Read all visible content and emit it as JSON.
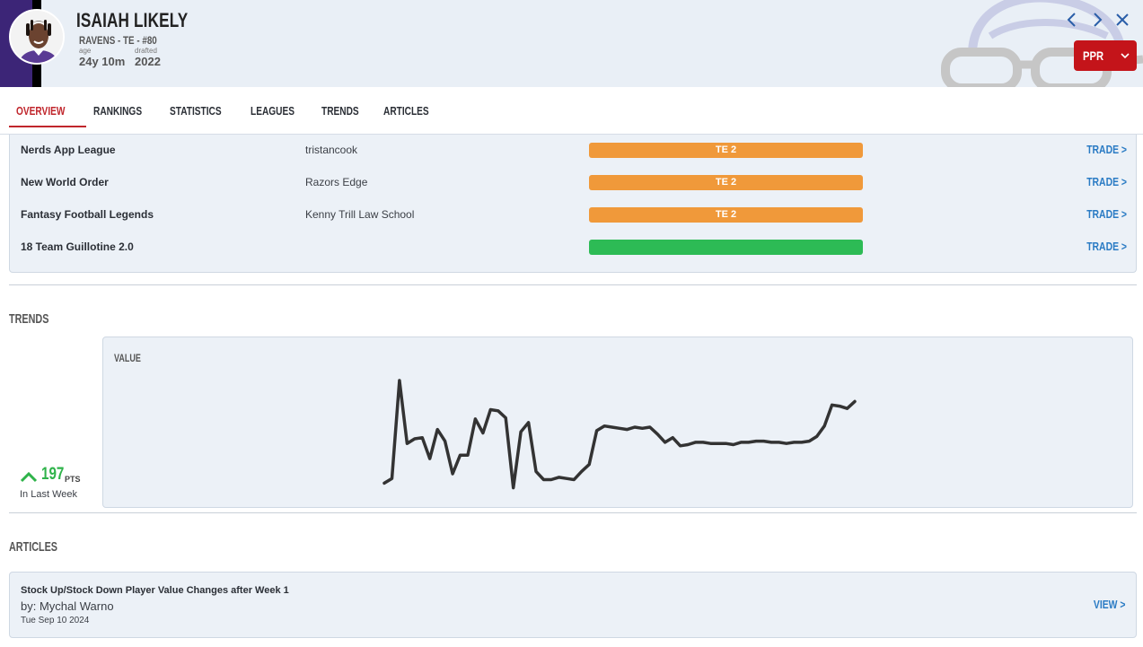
{
  "header": {
    "player_name": "ISAIAH LIKELY",
    "team_line": "RAVENS - TE - #80",
    "age_label": "age",
    "age_value": "24y 10m",
    "drafted_label": "drafted",
    "drafted_value": "2022",
    "scoring_format": "PPR",
    "team_colors": {
      "primary": "#3c2577",
      "secondary": "#000000"
    }
  },
  "nav": {
    "icons": [
      "chevron-left-icon",
      "chevron-right-icon",
      "close-icon"
    ]
  },
  "tabs": [
    {
      "label": "OVERVIEW",
      "active": true
    },
    {
      "label": "RANKINGS",
      "active": false
    },
    {
      "label": "STATISTICS",
      "active": false
    },
    {
      "label": "LEAGUES",
      "active": false
    },
    {
      "label": "TRENDS",
      "active": false
    },
    {
      "label": "ARTICLES",
      "active": false
    }
  ],
  "leagues": [
    {
      "name": "Nerds App League",
      "team": "tristancook",
      "rank": "TE 2",
      "color": "#f0993a",
      "action": "TRADE >"
    },
    {
      "name": "New World Order",
      "team": "Razors Edge",
      "rank": "TE 2",
      "color": "#f0993a",
      "action": "TRADE >"
    },
    {
      "name": "Fantasy Football Legends",
      "team": "Kenny Trill Law School",
      "rank": "TE 2",
      "color": "#f0993a",
      "action": "TRADE >"
    },
    {
      "name": "18 Team Guillotine 2.0",
      "team": "",
      "rank": "",
      "color": "#2dbb55",
      "action": "TRADE >"
    }
  ],
  "trends": {
    "section_title": "TRENDS",
    "change_value": "197",
    "change_unit": "PTS",
    "change_caption": "In Last Week",
    "change_direction": "up",
    "change_color": "#2fb34a"
  },
  "chart_data": {
    "type": "line",
    "title": "VALUE",
    "xlabel": "",
    "ylabel": "",
    "grid": false,
    "legend": "none",
    "ylim": [
      0,
      100
    ],
    "series": [
      {
        "color": "#333333",
        "values": [
          12,
          16,
          100,
          46,
          50,
          51,
          33,
          58,
          48,
          20,
          36,
          36,
          67,
          55,
          75,
          74,
          68,
          8,
          56,
          64,
          22,
          15,
          15,
          17,
          16,
          15,
          22,
          28,
          57,
          61,
          60,
          59,
          58,
          60,
          59,
          60,
          54,
          47,
          51,
          44,
          45,
          47,
          47,
          46,
          46,
          46,
          45,
          47,
          47,
          48,
          48,
          47,
          47,
          46,
          47,
          47,
          48,
          52,
          61,
          79,
          78,
          76,
          82
        ]
      }
    ]
  },
  "articles": {
    "section_title": "ARTICLES",
    "items": [
      {
        "title": "Stock Up/Stock Down Player Value Changes after Week 1",
        "author": "by: Mychal Warno",
        "date": "Tue Sep 10 2024",
        "action": "VIEW >"
      }
    ]
  }
}
